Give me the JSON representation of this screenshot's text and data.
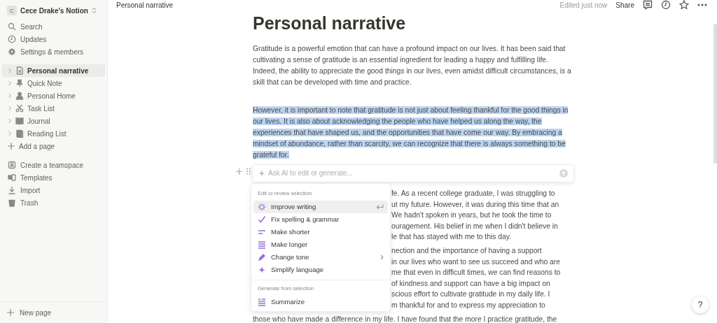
{
  "workspace": {
    "initial": "C",
    "name": "Cece Drake's Notion"
  },
  "sidebar": {
    "actions": [
      {
        "kind": "search",
        "label": "Search"
      },
      {
        "kind": "clock",
        "label": "Updates"
      },
      {
        "kind": "gear",
        "label": "Settings & members"
      }
    ],
    "pages": [
      {
        "kind": "doc",
        "label": "Personal narrative",
        "selected": true
      },
      {
        "kind": "pin",
        "label": "Quick Note",
        "selected": false
      },
      {
        "kind": "person",
        "label": "Personal Home",
        "selected": false
      },
      {
        "kind": "scissors",
        "label": "Task List",
        "selected": false
      },
      {
        "kind": "book",
        "label": "Journal",
        "selected": false
      },
      {
        "kind": "books",
        "label": "Reading List",
        "selected": false
      }
    ],
    "add_page": "Add a page",
    "tools": [
      {
        "kind": "team",
        "label": "Create a teamspace"
      },
      {
        "kind": "templates",
        "label": "Templates"
      },
      {
        "kind": "import",
        "label": "Import"
      },
      {
        "kind": "trash",
        "label": "Trash"
      }
    ],
    "new_page": "New page"
  },
  "topbar": {
    "breadcrumb": "Personal narrative",
    "edited": "Edited just now",
    "share": "Share"
  },
  "page": {
    "title": "Personal narrative",
    "paragraphs": [
      {
        "text": "Gratitude is a powerful emotion that can have a profound impact on our lives. It has been said that cultivating a sense of gratitude is an essential ingredient for leading a happy and fulfilling life. Indeed, the ability to appreciate the good things in our lives, even amidst difficult circumstances, is a skill that can be developed with time and practice.",
        "selected": false
      },
      {
        "text": "However, it is important to note that gratitude is not just about feeling thankful for the good things in our lives. It is also about acknowledging the people who have helped us along the way, the experiences that have shaped us, and the opportunities that have come our way. By embracing a mindset of abundance, rather than scarcity, we can recognize that there is always something to be grateful for.",
        "selected": true
      }
    ],
    "partial_paragraphs": [
      [
        "fe. As a recent college graduate, I was struggling to",
        "ut my future. However, it was during this time that an",
        "We hadn't spoken in years, but he took the time to",
        "ouragement. His belief in me when I didn't believe in",
        "le that has stayed with me to this day."
      ],
      [
        "nection and the importance of having a support",
        "in our lives who want to see us succeed and who are",
        "me that even in difficult times, we can find reasons to",
        "of kindness and support can have a big impact on",
        "scious effort to cultivate gratitude in my daily life. I",
        "m thankful for and to express my appreciation to"
      ]
    ],
    "last_line": "those who have made a difference in my life. I have found that the more I practice gratitude, the"
  },
  "ai_prompt": {
    "placeholder": "Ask AI to edit or generate..."
  },
  "ai_menu": [
    {
      "heading": "Edit or review selection",
      "items": [
        {
          "kind": "sparkle",
          "label": "Improve writing",
          "selected": true,
          "submenu": false
        },
        {
          "kind": "check",
          "label": "Fix spelling & grammar",
          "selected": false,
          "submenu": false
        },
        {
          "kind": "short",
          "label": "Make shorter",
          "selected": false,
          "submenu": false
        },
        {
          "kind": "long",
          "label": "Make longer",
          "selected": false,
          "submenu": false
        },
        {
          "kind": "pen",
          "label": "Change tone",
          "selected": false,
          "submenu": true
        },
        {
          "kind": "star",
          "label": "Simplify language",
          "selected": false,
          "submenu": false
        }
      ]
    },
    {
      "heading": "Generate from selection",
      "items": [
        {
          "kind": "summary",
          "label": "Summarize",
          "selected": false,
          "submenu": false
        }
      ]
    }
  ],
  "help": "?"
}
